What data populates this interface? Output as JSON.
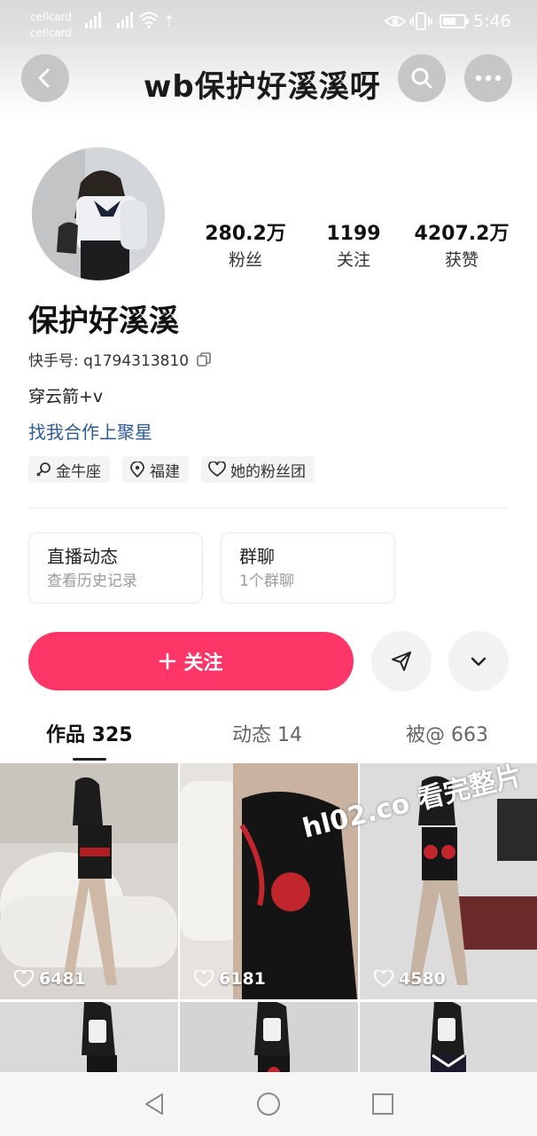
{
  "status_bar": {
    "carrier_1": "cellcard",
    "carrier_2": "cellcard",
    "time": "5:46",
    "icons": [
      "signal-icon",
      "signal-icon",
      "wifi-icon",
      "upload-icon",
      "eye-icon",
      "vibrate-icon",
      "battery-icon"
    ]
  },
  "header": {
    "title": "wb保护好溪溪呀",
    "icons": [
      "back-icon",
      "search-icon",
      "more-icon"
    ]
  },
  "profile": {
    "stats": [
      {
        "value": "280.2万",
        "label": "粉丝"
      },
      {
        "value": "1199",
        "label": "关注"
      },
      {
        "value": "4207.2万",
        "label": "获赞"
      }
    ],
    "name": "保护好溪溪",
    "kuaishou_id": "快手号: q1794313810",
    "bio": "穿云箭+v",
    "link": "找我合作上聚星",
    "tags": [
      {
        "icon": "zodiac-icon",
        "label": "金牛座"
      },
      {
        "icon": "location-icon",
        "label": "福建"
      },
      {
        "icon": "heart-group-icon",
        "label": "她的粉丝团"
      }
    ]
  },
  "cards": [
    {
      "title": "直播动态",
      "subtitle": "查看历史记录"
    },
    {
      "title": "群聊",
      "subtitle": "1个群聊"
    }
  ],
  "actions": {
    "follow_label": "关注",
    "icons": [
      "plus-icon",
      "send-icon",
      "chevron-down-icon"
    ]
  },
  "tabs": [
    {
      "label": "作品 325",
      "active": true
    },
    {
      "label": "动态 14",
      "active": false
    },
    {
      "label": "被@ 663",
      "active": false
    }
  ],
  "videos": [
    {
      "likes": "6481"
    },
    {
      "likes": "6181"
    },
    {
      "likes": "4580"
    },
    {
      "likes": ""
    },
    {
      "likes": ""
    },
    {
      "likes": ""
    }
  ],
  "watermark": "hl02.co 看完整片",
  "nav_bar": {
    "icons": [
      "nav-back-icon",
      "nav-home-icon",
      "nav-recents-icon"
    ]
  },
  "colors": {
    "accent": "#fe3667",
    "link": "#2b5b9a"
  }
}
